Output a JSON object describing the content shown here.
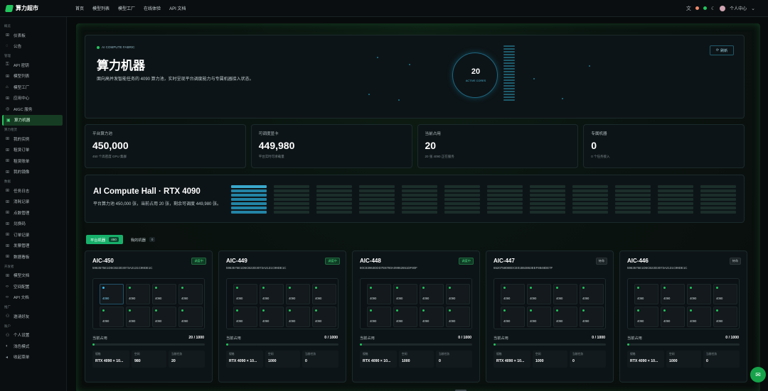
{
  "app": {
    "name": "算力超市"
  },
  "topnav": [
    "首页",
    "模型列表",
    "模型工厂",
    "在线体验",
    "API 文档"
  ],
  "topright": {
    "user": "个人中心",
    "dots": [
      "#ef8a6a",
      "#22c55e"
    ]
  },
  "sidebar": [
    {
      "section": "概览",
      "items": [
        {
          "icon": "grid-icon",
          "glyph": "⊞",
          "label": "仪表板"
        },
        {
          "icon": "bell-icon",
          "glyph": "◌",
          "label": "公告"
        }
      ]
    },
    {
      "section": "管理",
      "items": [
        {
          "icon": "key-icon",
          "glyph": "⚿",
          "label": "API 密钥"
        },
        {
          "icon": "list-icon",
          "glyph": "⊞",
          "label": "模型列表"
        },
        {
          "icon": "factory-icon",
          "glyph": "⌂",
          "label": "模型工厂"
        },
        {
          "icon": "apps-icon",
          "glyph": "⊞",
          "label": "应用中心"
        },
        {
          "icon": "service-icon",
          "glyph": "◎",
          "label": "AIGC 服务"
        },
        {
          "icon": "machine-icon",
          "glyph": "▣",
          "label": "算力机器",
          "active": true
        }
      ]
    },
    {
      "section": "算力租赁",
      "items": [
        {
          "icon": "instance-icon",
          "glyph": "⊞",
          "label": "我的实例"
        },
        {
          "icon": "order-icon",
          "glyph": "⊞",
          "label": "租赁订单"
        },
        {
          "icon": "bill-icon",
          "glyph": "⊞",
          "label": "租赁账单"
        },
        {
          "icon": "image-icon",
          "glyph": "⊞",
          "label": "我的镜像"
        }
      ]
    },
    {
      "section": "数据",
      "items": [
        {
          "icon": "log-icon",
          "glyph": "⊞",
          "label": "任务日志"
        },
        {
          "icon": "usage-icon",
          "glyph": "⊞",
          "label": "消耗记录"
        },
        {
          "icon": "recharge-icon",
          "glyph": "⊞",
          "label": "点数管理"
        },
        {
          "icon": "redeem-icon",
          "glyph": "⊞",
          "label": "兑换码"
        },
        {
          "icon": "record-icon",
          "glyph": "⊞",
          "label": "订单记录"
        },
        {
          "icon": "invoice-icon",
          "glyph": "⊞",
          "label": "发票管理"
        },
        {
          "icon": "stats-icon",
          "glyph": "⊞",
          "label": "数据看板"
        }
      ]
    },
    {
      "section": "开发者",
      "items": [
        {
          "icon": "doc-icon",
          "glyph": "⊞",
          "label": "模型文档"
        },
        {
          "icon": "code-icon",
          "glyph": "‹›",
          "label": "空间配置"
        },
        {
          "icon": "api-icon",
          "glyph": "‹›",
          "label": "API 文档"
        }
      ]
    },
    {
      "section": "推广",
      "items": [
        {
          "icon": "invite-icon",
          "glyph": "⚇",
          "label": "邀请好友"
        }
      ]
    },
    {
      "section": "账户",
      "items": [
        {
          "icon": "profile-icon",
          "glyph": "⚇",
          "label": "个人设置"
        },
        {
          "icon": "theme-icon",
          "glyph": "◐",
          "label": "浅色模式"
        },
        {
          "icon": "collapse-icon",
          "glyph": "◂",
          "label": "收起菜单"
        }
      ]
    }
  ],
  "hero": {
    "tag": "AI COMPUTE FABRIC",
    "title": "算力机器",
    "desc": "面向高并发智能任务的 4090 算力池，实时呈现平台调度能力与专属机器接入状态。",
    "ring_value": "20",
    "ring_label": "ACTIVE CORES",
    "refresh": "刷新"
  },
  "stats": [
    {
      "label": "平台算力池",
      "value": "450,000",
      "sub": "450 个高密度 GPU 集群"
    },
    {
      "label": "可调度显卡",
      "value": "449,980",
      "sub": "平台实时可承载量"
    },
    {
      "label": "当前占用",
      "value": "20",
      "sub": "20 张 4090 正在服务"
    },
    {
      "label": "专属机器",
      "value": "0",
      "sub": "0 个任务接入"
    }
  ],
  "hall": {
    "title": "AI Compute Hall · RTX 4090",
    "desc": "平台算力池 450,000 张，当前占用 20 张，剩余可调度 449,980 张。"
  },
  "tabs": [
    {
      "label": "平台机器",
      "count": "450",
      "active": true
    },
    {
      "label": "我的机器",
      "count": "0",
      "active": false
    }
  ],
  "cards": [
    {
      "name": "AIC-450",
      "id": "5963575E1D5CB22D3073A2131C99DE1C",
      "status": "调度中",
      "status_type": "g",
      "occ_label": "当前占用",
      "occ": "20 / 1000",
      "ratio": 0.02,
      "meta": [
        {
          "l": "规格",
          "v": "RTX 4090 × 10..."
        },
        {
          "l": "空闲",
          "v": "980"
        },
        {
          "l": "当前任务",
          "v": "20"
        }
      ]
    },
    {
      "name": "AIC-449",
      "id": "5963575E1D5CB22D3073A2131C99DE1C",
      "status": "调度中",
      "status_type": "g",
      "occ_label": "当前占用",
      "occ": "0 / 1000",
      "ratio": 0,
      "meta": [
        {
          "l": "规格",
          "v": "RTX 4090 × 10..."
        },
        {
          "l": "空闲",
          "v": "1000"
        },
        {
          "l": "当前任务",
          "v": "0"
        }
      ]
    },
    {
      "name": "AIC-448",
      "id": "80C83963DDD7E8780A09962651DF80F",
      "status": "调度中",
      "status_type": "g",
      "occ_label": "当前占用",
      "occ": "0 / 1000",
      "ratio": 0,
      "meta": [
        {
          "l": "规格",
          "v": "RTX 4090 × 10..."
        },
        {
          "l": "空闲",
          "v": "1000"
        },
        {
          "l": "当前任务",
          "v": "0"
        }
      ]
    },
    {
      "name": "AIC-447",
      "id": "6520758080DCE01B53863EEF8848DE7F",
      "status": "待命",
      "status_type": "n",
      "occ_label": "当前占用",
      "occ": "0 / 1000",
      "ratio": 0,
      "meta": [
        {
          "l": "规格",
          "v": "RTX 4090 × 10..."
        },
        {
          "l": "空闲",
          "v": "1000"
        },
        {
          "l": "当前任务",
          "v": "0"
        }
      ]
    },
    {
      "name": "AIC-446",
      "id": "5963575E1D5CB22D3073A2131C99DE1C",
      "status": "待命",
      "status_type": "n",
      "occ_label": "当前占用",
      "occ": "0 / 1000",
      "ratio": 0,
      "meta": [
        {
          "l": "规格",
          "v": "RTX 4090 × 10..."
        },
        {
          "l": "空闲",
          "v": "1000"
        },
        {
          "l": "当前任务",
          "v": "0"
        }
      ]
    }
  ],
  "gpu_label": "4090"
}
